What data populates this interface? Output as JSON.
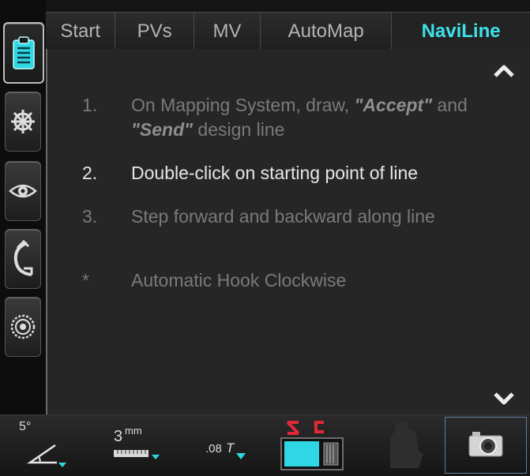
{
  "tabs": [
    {
      "label": "Start"
    },
    {
      "label": "PVs"
    },
    {
      "label": "MV"
    },
    {
      "label": "AutoMap"
    },
    {
      "label": "NaviLine",
      "active": true
    }
  ],
  "rail": {
    "items": [
      {
        "icon": "checklist-icon",
        "active": true
      },
      {
        "icon": "ship-wheel-icon"
      },
      {
        "icon": "eye-icon"
      },
      {
        "icon": "clamp-icon"
      },
      {
        "icon": "target-dial-icon"
      }
    ]
  },
  "steps": [
    {
      "num": "1.",
      "pre": "On Mapping System, draw, ",
      "b1": "\"Accept\"",
      "mid": " and ",
      "b2": "\"Send\"",
      "post": " design line",
      "state": "dim"
    },
    {
      "num": "2.",
      "text": "Double-click on starting point of line",
      "state": "current"
    },
    {
      "num": "3.",
      "text": "Step forward and backward along line",
      "state": "dim"
    },
    {
      "num": "*",
      "text": "Automatic Hook Clockwise",
      "state": "dim"
    }
  ],
  "toolbar": {
    "angle": {
      "value": "5°",
      "icon": "angle-icon"
    },
    "ruler": {
      "value": "3",
      "unit": "mm",
      "icon": "ruler-icon"
    },
    "tool": {
      "value": ".08",
      "suffix": "T",
      "icon": "tool-size-icon"
    },
    "magnet": {
      "icon": "magnet-toggle-icon"
    },
    "probe": {
      "icon": "probe-icon"
    },
    "camera": {
      "icon": "camera-icon"
    }
  },
  "colors": {
    "accent": "#3fe0ea",
    "highlight": "#2fd6e4",
    "magnet": "#e0283a"
  }
}
